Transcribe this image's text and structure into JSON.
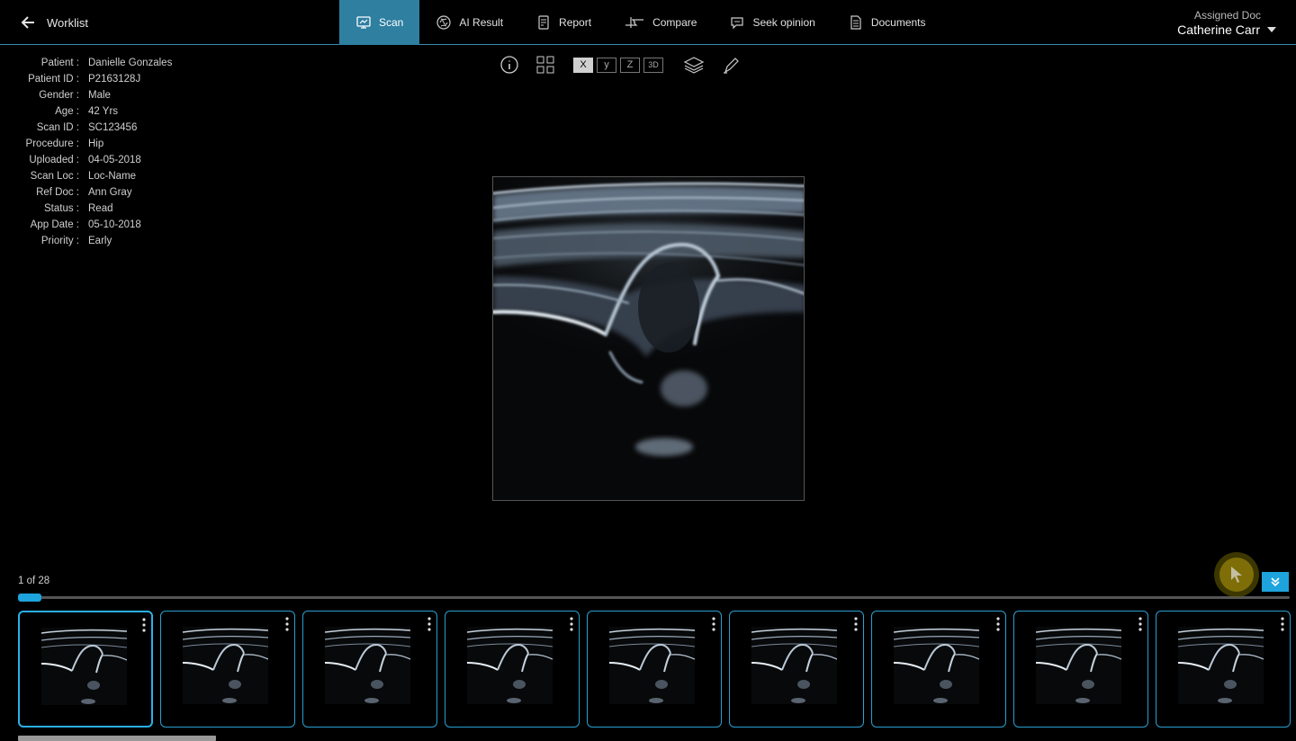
{
  "nav": {
    "back_label": "Worklist",
    "tabs": [
      {
        "label": "Scan",
        "icon": "monitor-icon",
        "active": true
      },
      {
        "label": "AI Result",
        "icon": "brain-icon",
        "active": false
      },
      {
        "label": "Report",
        "icon": "report-icon",
        "active": false
      },
      {
        "label": "Compare",
        "icon": "compare-arrows-icon",
        "active": false
      },
      {
        "label": "Seek opinion",
        "icon": "chat-bubble-icon",
        "active": false
      },
      {
        "label": "Documents",
        "icon": "document-icon",
        "active": false
      }
    ],
    "assigned_label": "Assigned Doc",
    "assigned_doc": "Catherine Carr"
  },
  "patient": {
    "fields": [
      {
        "key": "Patient :",
        "value": "Danielle Gonzales"
      },
      {
        "key": "Patient ID :",
        "value": "P2163128J"
      },
      {
        "key": "Gender :",
        "value": "Male"
      },
      {
        "key": "Age :",
        "value": "42 Yrs"
      },
      {
        "key": "Scan ID :",
        "value": "SC123456"
      },
      {
        "key": "Procedure :",
        "value": "Hip"
      },
      {
        "key": "Uploaded :",
        "value": "04-05-2018"
      },
      {
        "key": "Scan Loc :",
        "value": "Loc-Name"
      },
      {
        "key": "Ref Doc :",
        "value": "Ann Gray"
      },
      {
        "key": "Status :",
        "value": "Read"
      },
      {
        "key": "App Date :",
        "value": "05-10-2018"
      },
      {
        "key": "Priority :",
        "value": "Early"
      }
    ]
  },
  "tools": {
    "axes": [
      {
        "label": "X",
        "active": true
      },
      {
        "label": "y",
        "active": false
      },
      {
        "label": "Z",
        "active": false
      },
      {
        "label": "3D",
        "active": false
      }
    ]
  },
  "viewer": {
    "counter": "1 of 28",
    "current_index": 1,
    "total": 28,
    "thumbnail_count": 9
  },
  "colors": {
    "accent": "#2e7fa0",
    "highlight": "#1ea4dc"
  }
}
